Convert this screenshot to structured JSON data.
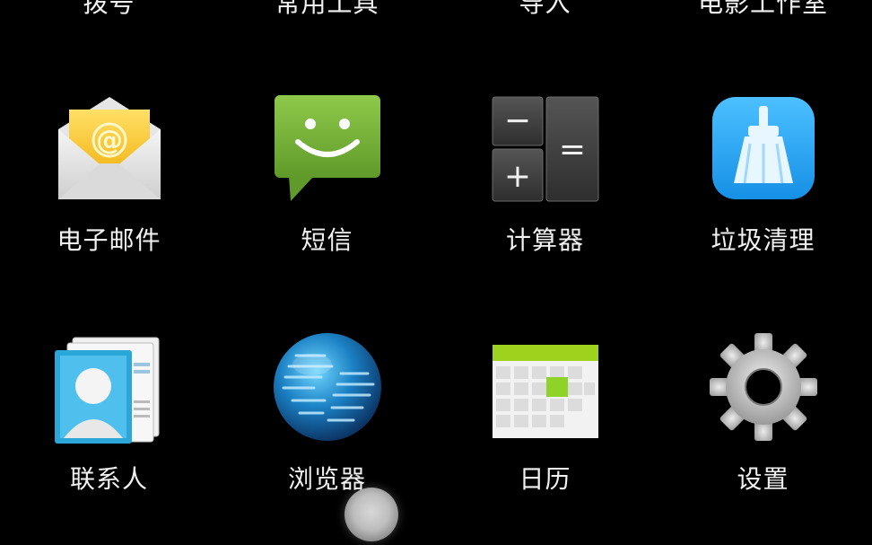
{
  "top_row": [
    {
      "label": "拨号"
    },
    {
      "label": "常用工具"
    },
    {
      "label": "导入"
    },
    {
      "label": "电影工作室"
    }
  ],
  "apps": [
    {
      "label": "电子邮件",
      "icon": "email-envelope-icon"
    },
    {
      "label": "短信",
      "icon": "sms-bubble-icon"
    },
    {
      "label": "计算器",
      "icon": "calculator-icon"
    },
    {
      "label": "垃圾清理",
      "icon": "broom-cleaner-icon"
    },
    {
      "label": "联系人",
      "icon": "contacts-icon"
    },
    {
      "label": "浏览器",
      "icon": "globe-browser-icon"
    },
    {
      "label": "日历",
      "icon": "calendar-icon"
    },
    {
      "label": "设置",
      "icon": "gear-icon"
    }
  ],
  "icons": {
    "email_symbol": "@",
    "calculator_keys": [
      "−",
      "=",
      "+"
    ]
  },
  "colors": {
    "background": "#000000",
    "sms_green": "#7cb342",
    "cleaner_blue": "#29a8f5",
    "calendar_green": "#9ed21d",
    "email_yellow": "#ffd23a"
  }
}
